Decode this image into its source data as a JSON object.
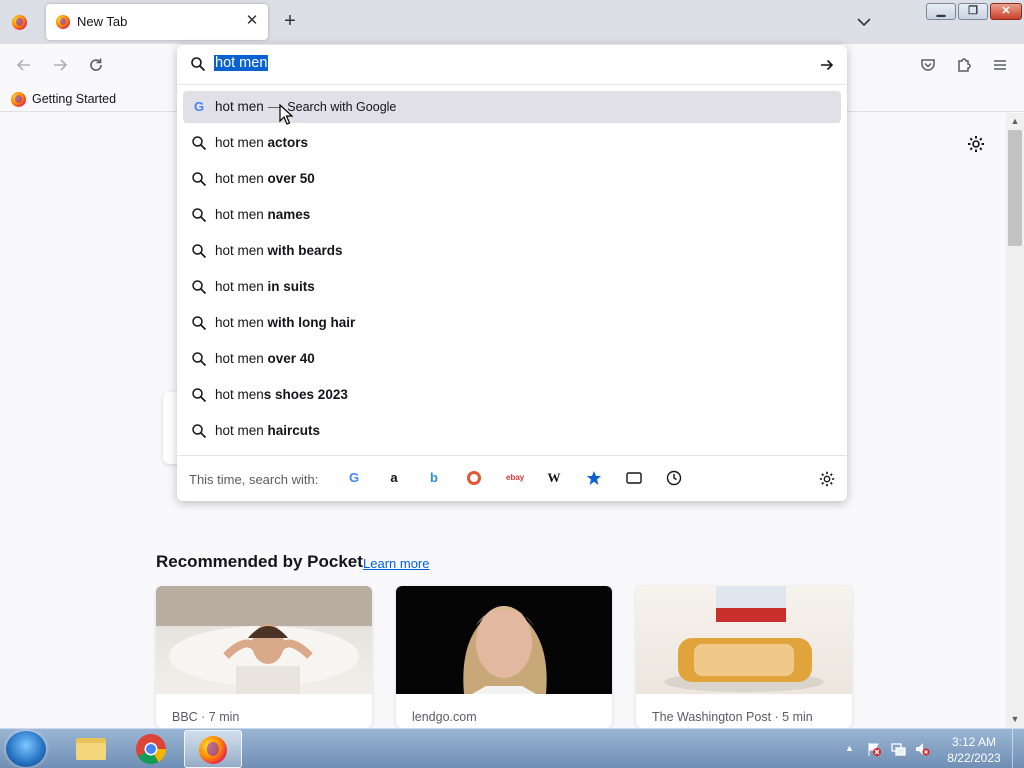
{
  "tabs": [
    {
      "label": "New Tab"
    }
  ],
  "bookmarks": [
    {
      "label": "Getting Started"
    }
  ],
  "urlbar": {
    "query": "hot men",
    "suggestions": [
      {
        "prefix": "hot men",
        "bold": "",
        "action": "Search with Google",
        "engine_icon": "google-icon"
      },
      {
        "prefix": "hot men ",
        "bold": "actors"
      },
      {
        "prefix": "hot men ",
        "bold": "over 50"
      },
      {
        "prefix": "hot men ",
        "bold": "names"
      },
      {
        "prefix": "hot men ",
        "bold": "with beards"
      },
      {
        "prefix": "hot men ",
        "bold": "in suits"
      },
      {
        "prefix": "hot men ",
        "bold": "with long hair"
      },
      {
        "prefix": "hot men ",
        "bold": "over 40"
      },
      {
        "prefix": "hot men",
        "bold": "s shoes 2023"
      },
      {
        "prefix": "hot men ",
        "bold": "haircuts"
      }
    ],
    "one_off_label": "This time, search with:",
    "one_off_engines": [
      "google",
      "amazon",
      "bing",
      "duckduckgo",
      "ebay",
      "wikipedia",
      "bookmarks",
      "tabs",
      "history"
    ]
  },
  "pocket": {
    "heading": "Recommended by Pocket",
    "learn_more": "Learn more",
    "cards": [
      {
        "source": "BBC · 7 min"
      },
      {
        "source": "lendgo.com"
      },
      {
        "source": "The Washington Post · 5 min"
      }
    ]
  },
  "taskbar": {
    "time": "3:12 AM",
    "date": "8/22/2023"
  },
  "colors": {
    "accent": "#0a62d0",
    "link": "#0061e0",
    "selected_row": "#e0e0e6"
  }
}
